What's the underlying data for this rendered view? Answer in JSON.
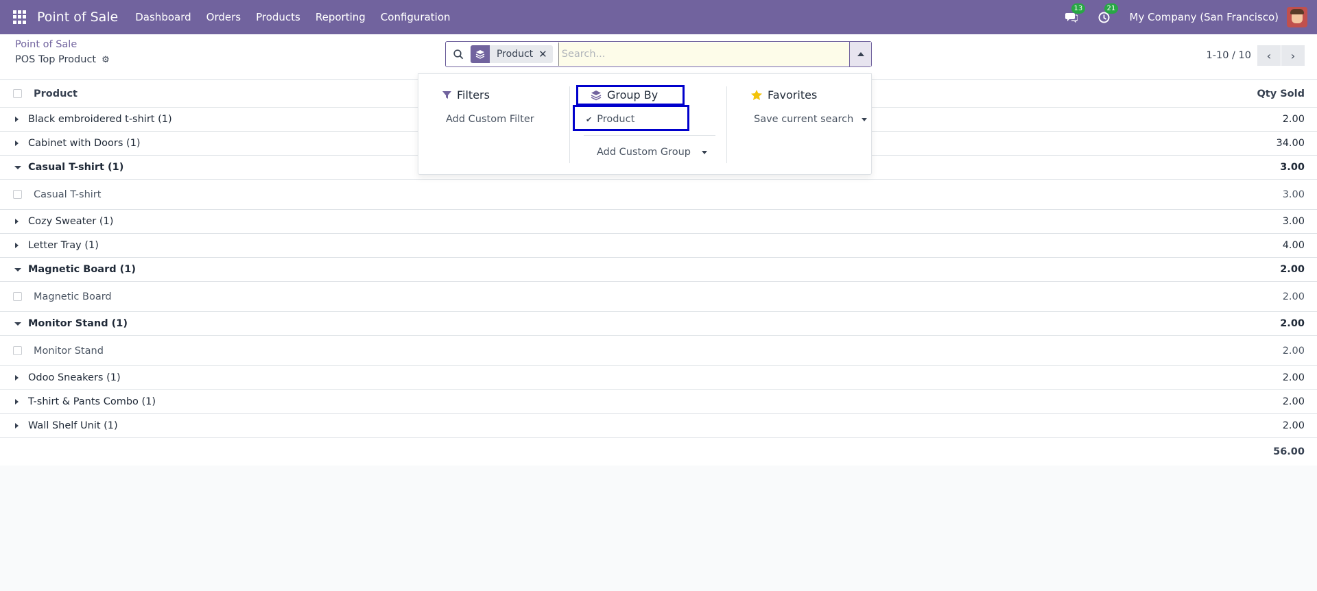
{
  "navbar": {
    "app_name": "Point of Sale",
    "menu": [
      "Dashboard",
      "Orders",
      "Products",
      "Reporting",
      "Configuration"
    ],
    "messages_count": "13",
    "activities_count": "21",
    "company": "My Company (San Francisco)",
    "color": "#71639e"
  },
  "control_panel": {
    "breadcrumb": "Point of Sale",
    "title": "POS Top Product",
    "pager": "1-10 / 10"
  },
  "search": {
    "facet_label": "Product",
    "placeholder": "Search..."
  },
  "dropdown": {
    "filters_title": "Filters",
    "add_custom_filter": "Add Custom Filter",
    "groupby_title": "Group By",
    "groupby_option": "Product",
    "add_custom_group": "Add Custom Group",
    "favorites_title": "Favorites",
    "save_current_search": "Save current search"
  },
  "list": {
    "columns": {
      "product": "Product",
      "qty": "Qty Sold"
    },
    "rows": [
      {
        "kind": "group",
        "open": false,
        "label": "Black embroidered t-shirt (1)",
        "qty": "2.00"
      },
      {
        "kind": "group",
        "open": false,
        "label": "Cabinet with Doors (1)",
        "qty": "34.00"
      },
      {
        "kind": "group",
        "open": true,
        "label": "Casual T-shirt (1)",
        "qty": "3.00"
      },
      {
        "kind": "record",
        "label": "Casual T-shirt",
        "qty": "3.00"
      },
      {
        "kind": "group",
        "open": false,
        "label": "Cozy Sweater (1)",
        "qty": "3.00"
      },
      {
        "kind": "group",
        "open": false,
        "label": "Letter Tray (1)",
        "qty": "4.00"
      },
      {
        "kind": "group",
        "open": true,
        "label": "Magnetic Board (1)",
        "qty": "2.00"
      },
      {
        "kind": "record",
        "label": "Magnetic Board",
        "qty": "2.00"
      },
      {
        "kind": "group",
        "open": true,
        "label": "Monitor Stand (1)",
        "qty": "2.00"
      },
      {
        "kind": "record",
        "label": "Monitor Stand",
        "qty": "2.00"
      },
      {
        "kind": "group",
        "open": false,
        "label": "Odoo Sneakers (1)",
        "qty": "2.00"
      },
      {
        "kind": "group",
        "open": false,
        "label": "T-shirt & Pants Combo (1)",
        "qty": "2.00"
      },
      {
        "kind": "group",
        "open": false,
        "label": "Wall Shelf Unit (1)",
        "qty": "2.00"
      }
    ],
    "total": "56.00"
  }
}
